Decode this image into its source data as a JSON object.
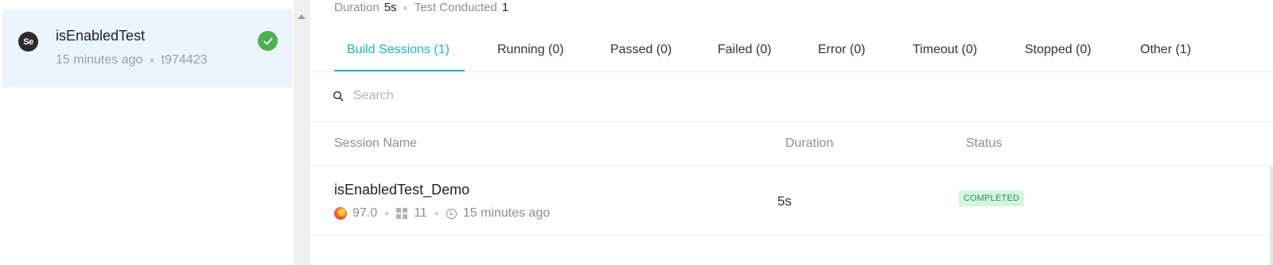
{
  "build": {
    "logo_text": "Se",
    "name": "isEnabledTest",
    "time_ago": "15 minutes ago",
    "build_id": "t974423",
    "status_icon": "check-icon",
    "status_color": "#4caf50"
  },
  "summary": {
    "duration_label": "Duration",
    "duration_value": "5s",
    "tests_label": "Test Conducted",
    "tests_value": "1"
  },
  "tabs": [
    {
      "label": "Build Sessions (1)",
      "active": true
    },
    {
      "label": "Running (0)"
    },
    {
      "label": "Passed (0)"
    },
    {
      "label": "Failed (0)"
    },
    {
      "label": "Error (0)"
    },
    {
      "label": "Timeout (0)"
    },
    {
      "label": "Stopped (0)"
    },
    {
      "label": "Other (1)"
    }
  ],
  "search": {
    "placeholder": "Search",
    "value": ""
  },
  "table": {
    "headers": [
      "Session Name",
      "Duration",
      "Status"
    ],
    "rows": [
      {
        "name": "isEnabledTest_Demo",
        "browser_icon": "firefox-icon",
        "browser_version": "97.0",
        "os_icon": "windows-icon",
        "os_version": "11",
        "time_icon": "clock-icon",
        "time_ago": "15 minutes ago",
        "duration": "5s",
        "status": "COMPLETED"
      }
    ]
  },
  "colors": {
    "accent": "#1fb2c9",
    "selected_bg": "#ebf3fd",
    "completed_bg": "#d4f5e0",
    "completed_text": "#3a8a5a"
  }
}
